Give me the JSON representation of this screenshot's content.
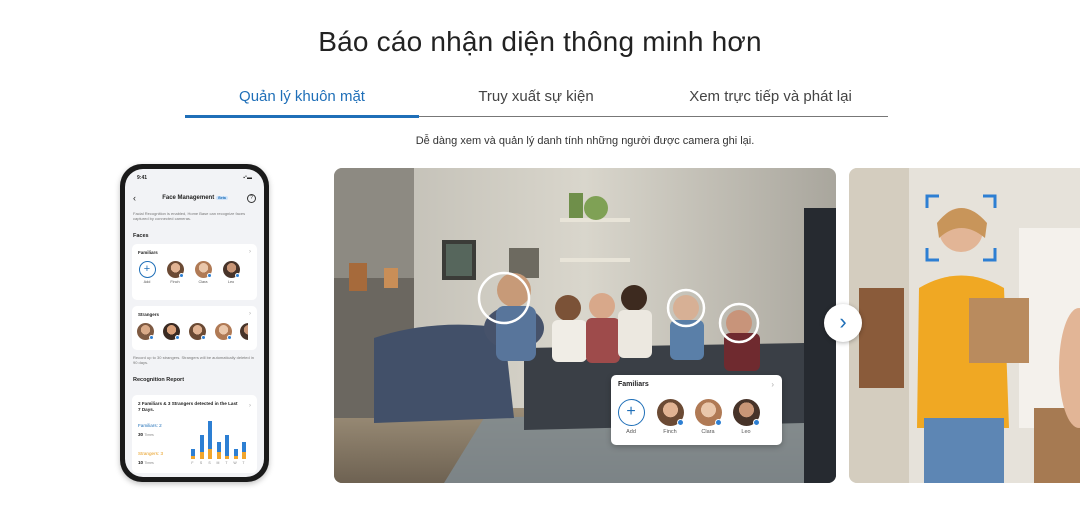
{
  "heading": "Báo cáo nhận diện thông minh hơn",
  "tabs": [
    {
      "label": "Quản lý khuôn mặt",
      "active": true
    },
    {
      "label": "Truy xuất sự kiện",
      "active": false
    },
    {
      "label": "Xem trực tiếp và phát lại",
      "active": false
    }
  ],
  "subtitle": "Dễ dàng xem và quản lý danh tính những người được camera ghi lại.",
  "accent_color": "#1f6fb8",
  "phone": {
    "time": "9:41",
    "status_icons": "▪ᐤ▬",
    "title": "Face Management",
    "beta": "Beta",
    "help_icon": "?",
    "back_icon": "‹",
    "description": "Facial Recognition is enabled, Home Base can recognize faces captured by connected cameras.",
    "faces_label": "Faces",
    "familiars_label": "Familiars",
    "familiars": [
      {
        "name": "Add"
      },
      {
        "name": "Finch"
      },
      {
        "name": "Clara"
      },
      {
        "name": "Leo"
      }
    ],
    "strangers_label": "Strangers",
    "strangers_note": "Record up to 30 strangers. Strangers will be automatically deleted in 90 days.",
    "report_label": "Recognition Report",
    "report_summary": "2 Familiars & 3 Strangers detected in the Last 7 Days.",
    "familiars_count_label": "Familiars: 2",
    "familiars_times": "30",
    "strangers_count_label": "Strangers: 3",
    "strangers_times": "10",
    "times_unit": "Times",
    "days": [
      "F",
      "S",
      "S",
      "M",
      "T",
      "W",
      "T"
    ],
    "bars": [
      {
        "familiar": 2,
        "stranger": 1
      },
      {
        "familiar": 5,
        "stranger": 2
      },
      {
        "familiar": 8,
        "stranger": 3
      },
      {
        "familiar": 3,
        "stranger": 2
      },
      {
        "familiar": 6,
        "stranger": 1
      },
      {
        "familiar": 2,
        "stranger": 1
      },
      {
        "familiar": 3,
        "stranger": 2
      }
    ]
  },
  "overlay": {
    "title": "Familiars",
    "items": [
      "Add",
      "Finch",
      "Clara",
      "Leo"
    ]
  },
  "next_icon": "›"
}
